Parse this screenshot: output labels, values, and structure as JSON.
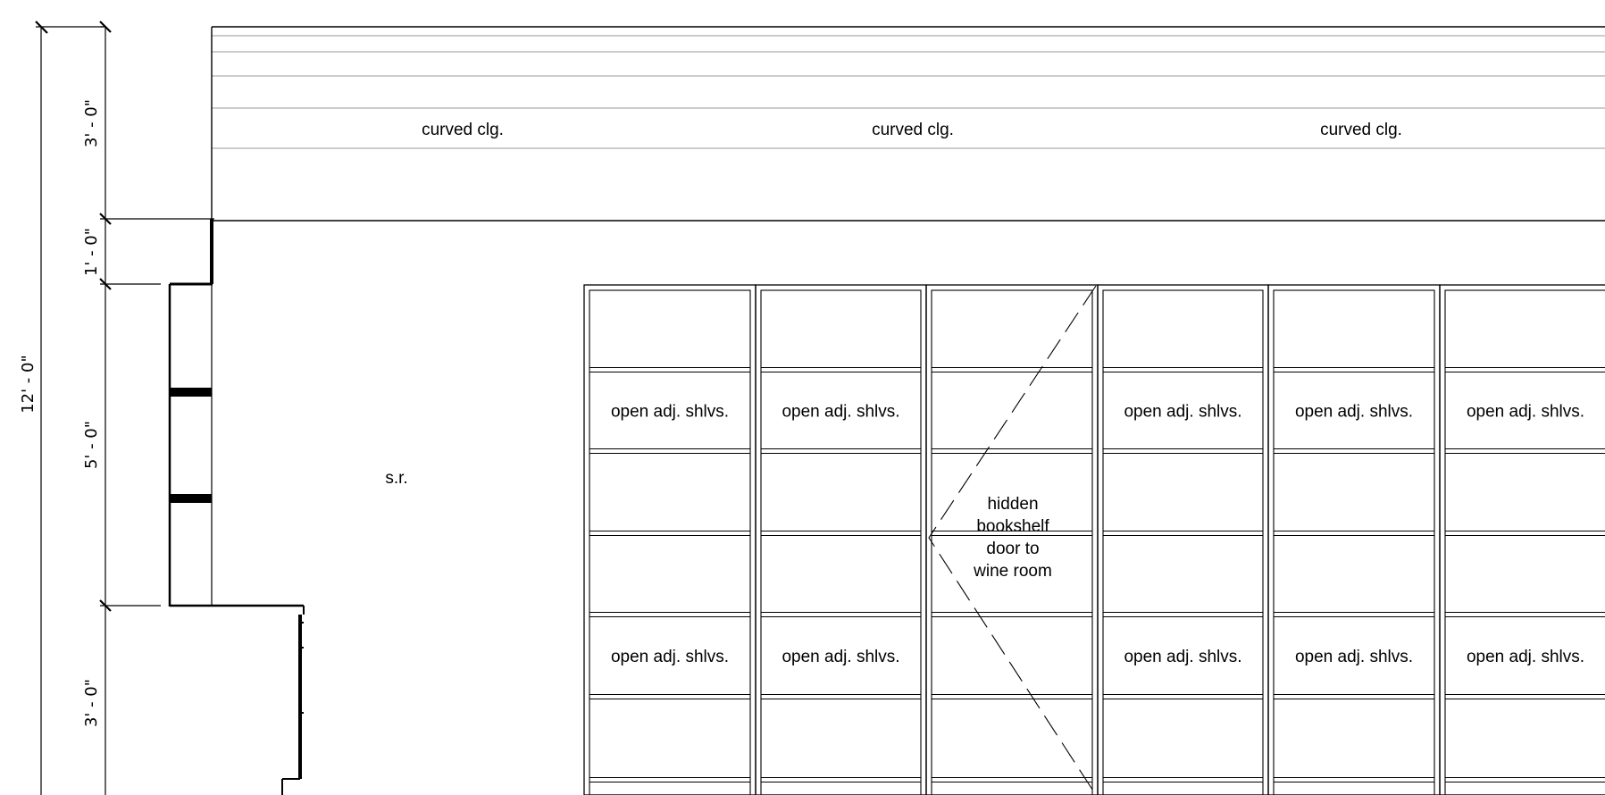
{
  "dimensions": {
    "overall": "12' - 0\"",
    "segment_1": "3' - 0\"",
    "segment_2": "1' - 0\"",
    "segment_3": "5' - 0\"",
    "segment_4": "3' - 0\""
  },
  "ceiling": {
    "labels": [
      "curved clg.",
      "curved clg.",
      "curved clg."
    ]
  },
  "wall": {
    "label": "s.r."
  },
  "bookshelf": {
    "shelf_label": "open adj. shlvs.",
    "door_label": [
      "hidden",
      "bookshelf",
      "door to",
      "wine room"
    ]
  }
}
